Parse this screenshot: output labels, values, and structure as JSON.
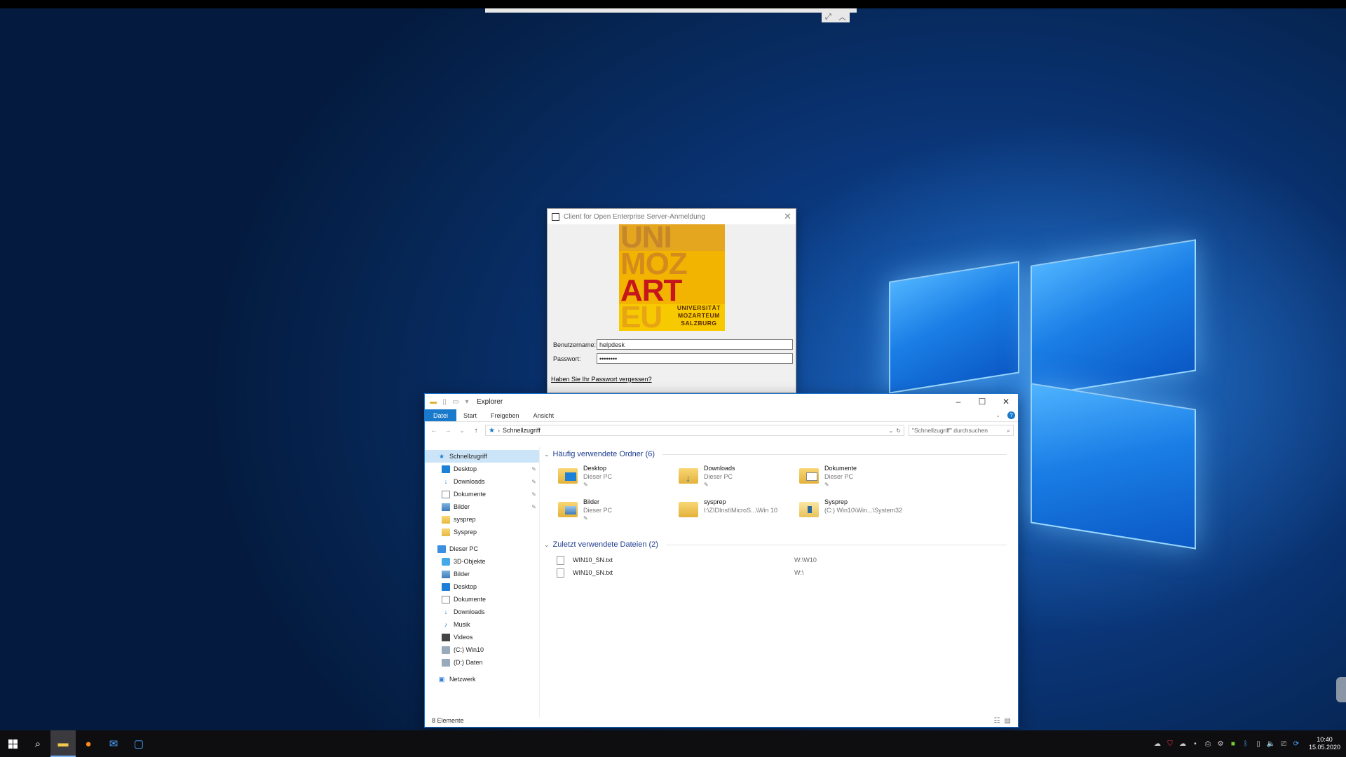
{
  "remote": {
    "controls": [
      "⤢",
      "︿"
    ]
  },
  "login": {
    "title": "Client for Open Enterprise Server-Anmeldung",
    "logo_rows": [
      "UNI",
      "MOZ",
      "ART",
      "EU"
    ],
    "logo_sub": [
      "UNIVERSITÄT",
      "MOZARTEUM",
      "SALZBURG"
    ],
    "username_label": "Benutzername:",
    "username_value": "helpdesk",
    "password_label": "Passwort:",
    "password_value": "••••••••",
    "forgot_link": "Haben Sie Ihr Passwort vergessen?"
  },
  "explorer": {
    "title": "Explorer",
    "tabs": [
      "Datei",
      "Start",
      "Freigeben",
      "Ansicht"
    ],
    "address": "Schnellzugriff",
    "search_placeholder": "\"Schnellzugriff\" durchsuchen",
    "nav": {
      "quick_access": "Schnellzugriff",
      "quick_items": [
        {
          "label": "Desktop",
          "icon": "desktop-icon",
          "pinned": true
        },
        {
          "label": "Downloads",
          "icon": "download-icon",
          "pinned": true
        },
        {
          "label": "Dokumente",
          "icon": "document-icon",
          "pinned": true
        },
        {
          "label": "Bilder",
          "icon": "pictures-icon",
          "pinned": true
        },
        {
          "label": "sysprep",
          "icon": "folder-icon",
          "pinned": false
        },
        {
          "label": "Sysprep",
          "icon": "folder-icon",
          "pinned": false
        }
      ],
      "this_pc": "Dieser PC",
      "pc_items": [
        {
          "label": "3D-Objekte",
          "icon": "3d-objects-icon"
        },
        {
          "label": "Bilder",
          "icon": "pictures-icon"
        },
        {
          "label": "Desktop",
          "icon": "desktop-icon"
        },
        {
          "label": "Dokumente",
          "icon": "document-icon"
        },
        {
          "label": "Downloads",
          "icon": "download-icon"
        },
        {
          "label": "Musik",
          "icon": "music-icon"
        },
        {
          "label": "Videos",
          "icon": "video-icon"
        },
        {
          "label": "(C:) Win10",
          "icon": "drive-icon"
        },
        {
          "label": "(D:) Daten",
          "icon": "drive-icon"
        }
      ],
      "network": "Netzwerk"
    },
    "frequent": {
      "heading": "Häufig verwendete Ordner (6)",
      "folders": [
        {
          "name": "Desktop",
          "sub": "Dieser PC",
          "pinned": true
        },
        {
          "name": "Downloads",
          "sub": "Dieser PC",
          "pinned": true
        },
        {
          "name": "Dokumente",
          "sub": "Dieser PC",
          "pinned": true
        },
        {
          "name": "Bilder",
          "sub": "Dieser PC",
          "pinned": true
        },
        {
          "name": "sysprep",
          "sub": "I:\\ZIDInst\\MicroS...\\Win 10",
          "pinned": false
        },
        {
          "name": "Sysprep",
          "sub": "(C:) Win10\\Win...\\System32",
          "pinned": false
        }
      ]
    },
    "recent": {
      "heading": "Zuletzt verwendete Dateien (2)",
      "files": [
        {
          "name": "WIN10_SN.txt",
          "path": "W:\\W10"
        },
        {
          "name": "WIN10_SN.txt",
          "path": "W:\\"
        }
      ]
    },
    "status": "8 Elemente"
  },
  "taskbar": {
    "clock_time": "10:40",
    "clock_date": "15.05.2020"
  }
}
